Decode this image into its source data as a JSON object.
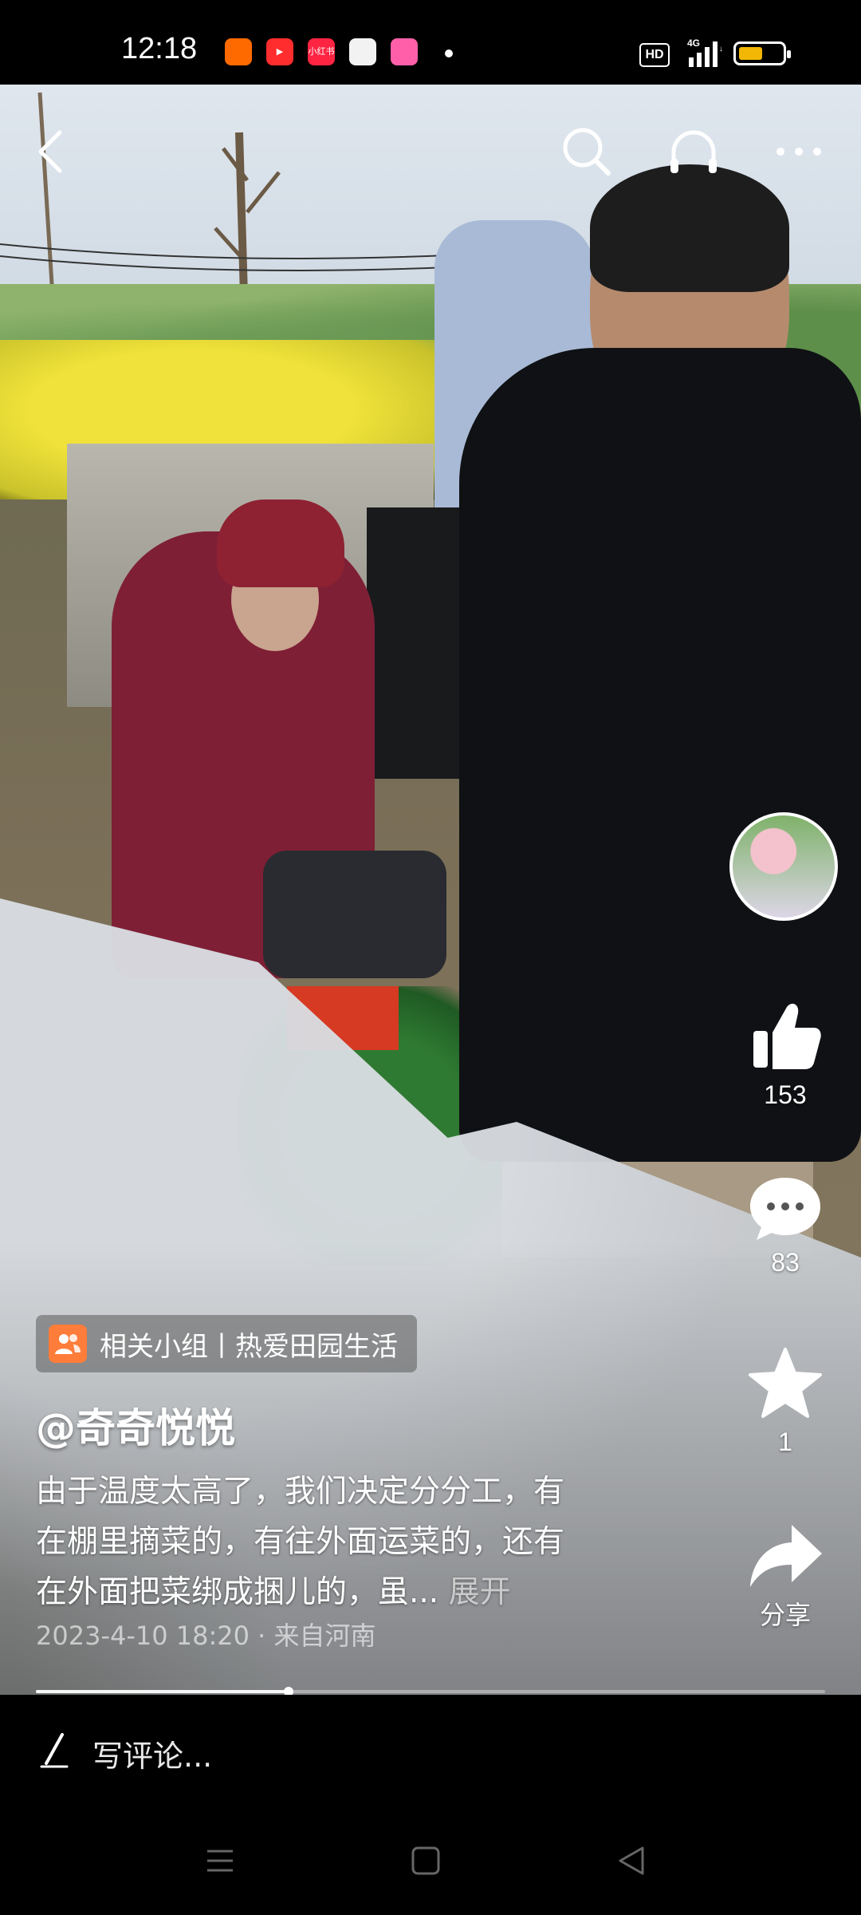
{
  "status_bar": {
    "time": "12:18",
    "notifications": [
      {
        "name": "app-orange-icon",
        "color": "#ff6a00",
        "text": ""
      },
      {
        "name": "video-play-app-icon",
        "color": "#ff2d2d",
        "text": "▶"
      },
      {
        "name": "xiaohongshu-app-icon",
        "color": "#ff2442",
        "text": "小红书"
      },
      {
        "name": "wallet-app-icon",
        "color": "#f2f2f2",
        "text": ""
      },
      {
        "name": "pink-app-icon",
        "color": "#ff5fa8",
        "text": ""
      }
    ],
    "hd_label": "HD",
    "network_label": "4G",
    "battery_level": 0.55
  },
  "video": {
    "progress": 0.32
  },
  "top_nav": {
    "back_icon": "chevron-left",
    "search_icon": "search",
    "listen_icon": "headphones",
    "more_icon": "ellipsis"
  },
  "actions": {
    "like_count": "153",
    "comment_count": "83",
    "favorite_count": "1",
    "share_label": "分享"
  },
  "post": {
    "group_tag": "相关小组丨热爱田园生活",
    "author": "@奇奇悦悦",
    "caption_lines": [
      "由于温度太高了，我们决定分分工，有",
      "在棚里摘菜的，有往外面运菜的，还有",
      "在外面把菜绑成捆儿的，虽..."
    ],
    "expand_label": "展开",
    "meta": "2023-4-10 18:20 · 来自河南"
  },
  "comment_bar": {
    "placeholder": "写评论..."
  },
  "colors": {
    "accent_orange": "#ff7d3a",
    "battery_yellow": "#f2b705"
  }
}
